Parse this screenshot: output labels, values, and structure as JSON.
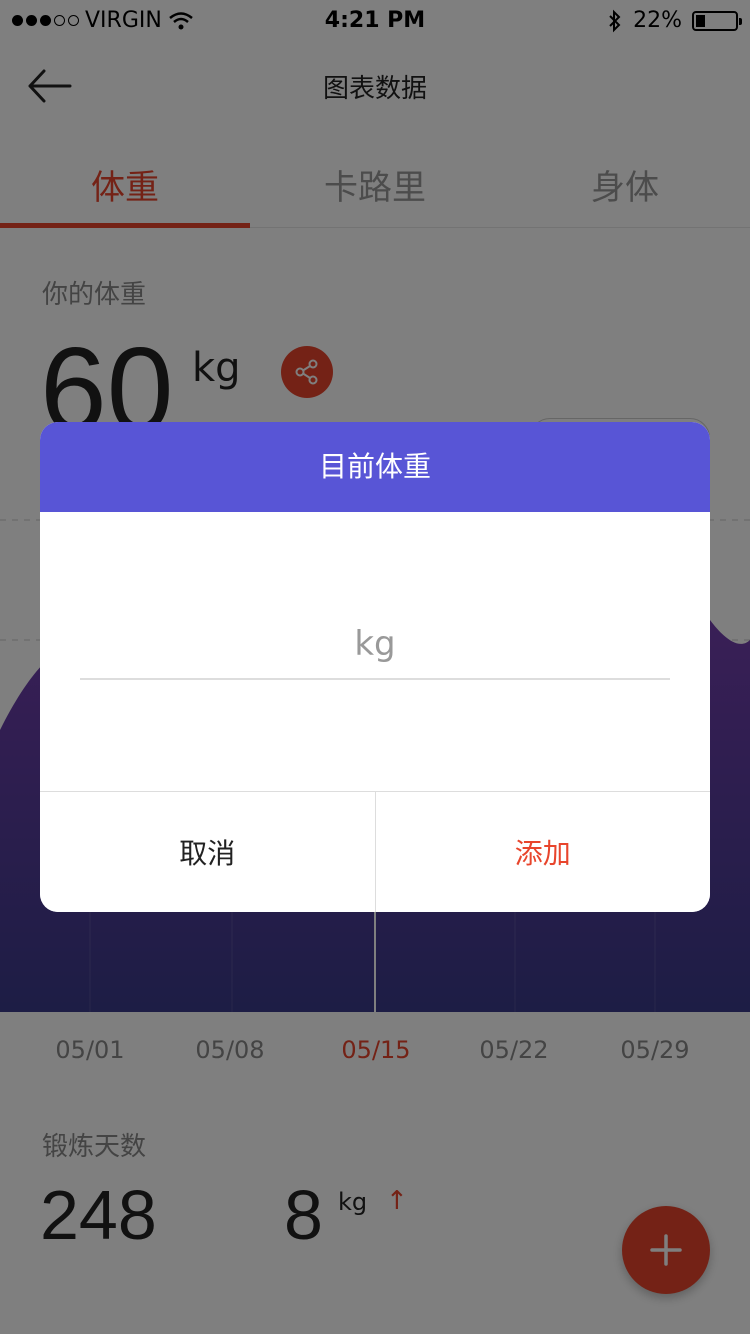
{
  "status_bar": {
    "carrier": "VIRGIN",
    "time": "4:21 PM",
    "battery": "22%"
  },
  "nav": {
    "title": "图表数据"
  },
  "tabs": [
    {
      "label": "体重",
      "active": true
    },
    {
      "label": "卡路里",
      "active": false
    },
    {
      "label": "身体",
      "active": false
    }
  ],
  "weight": {
    "label": "你的体重",
    "value": "60",
    "unit": "kg"
  },
  "x_axis": {
    "labels": [
      "05/01",
      "05/08",
      "05/15",
      "05/22",
      "05/29"
    ],
    "active_index": 2
  },
  "exercise": {
    "label": "锻炼天数",
    "days": "248",
    "change_value": "8",
    "change_unit": "kg"
  },
  "dialog": {
    "title": "目前体重",
    "input_placeholder": "kg",
    "input_value": "",
    "cancel_label": "取消",
    "add_label": "添加"
  },
  "colors": {
    "accent": "#e8452c",
    "dialog_header": "#5855d6",
    "chart_top": "#7b3fb2",
    "chart_bottom": "#3a3a8a"
  }
}
